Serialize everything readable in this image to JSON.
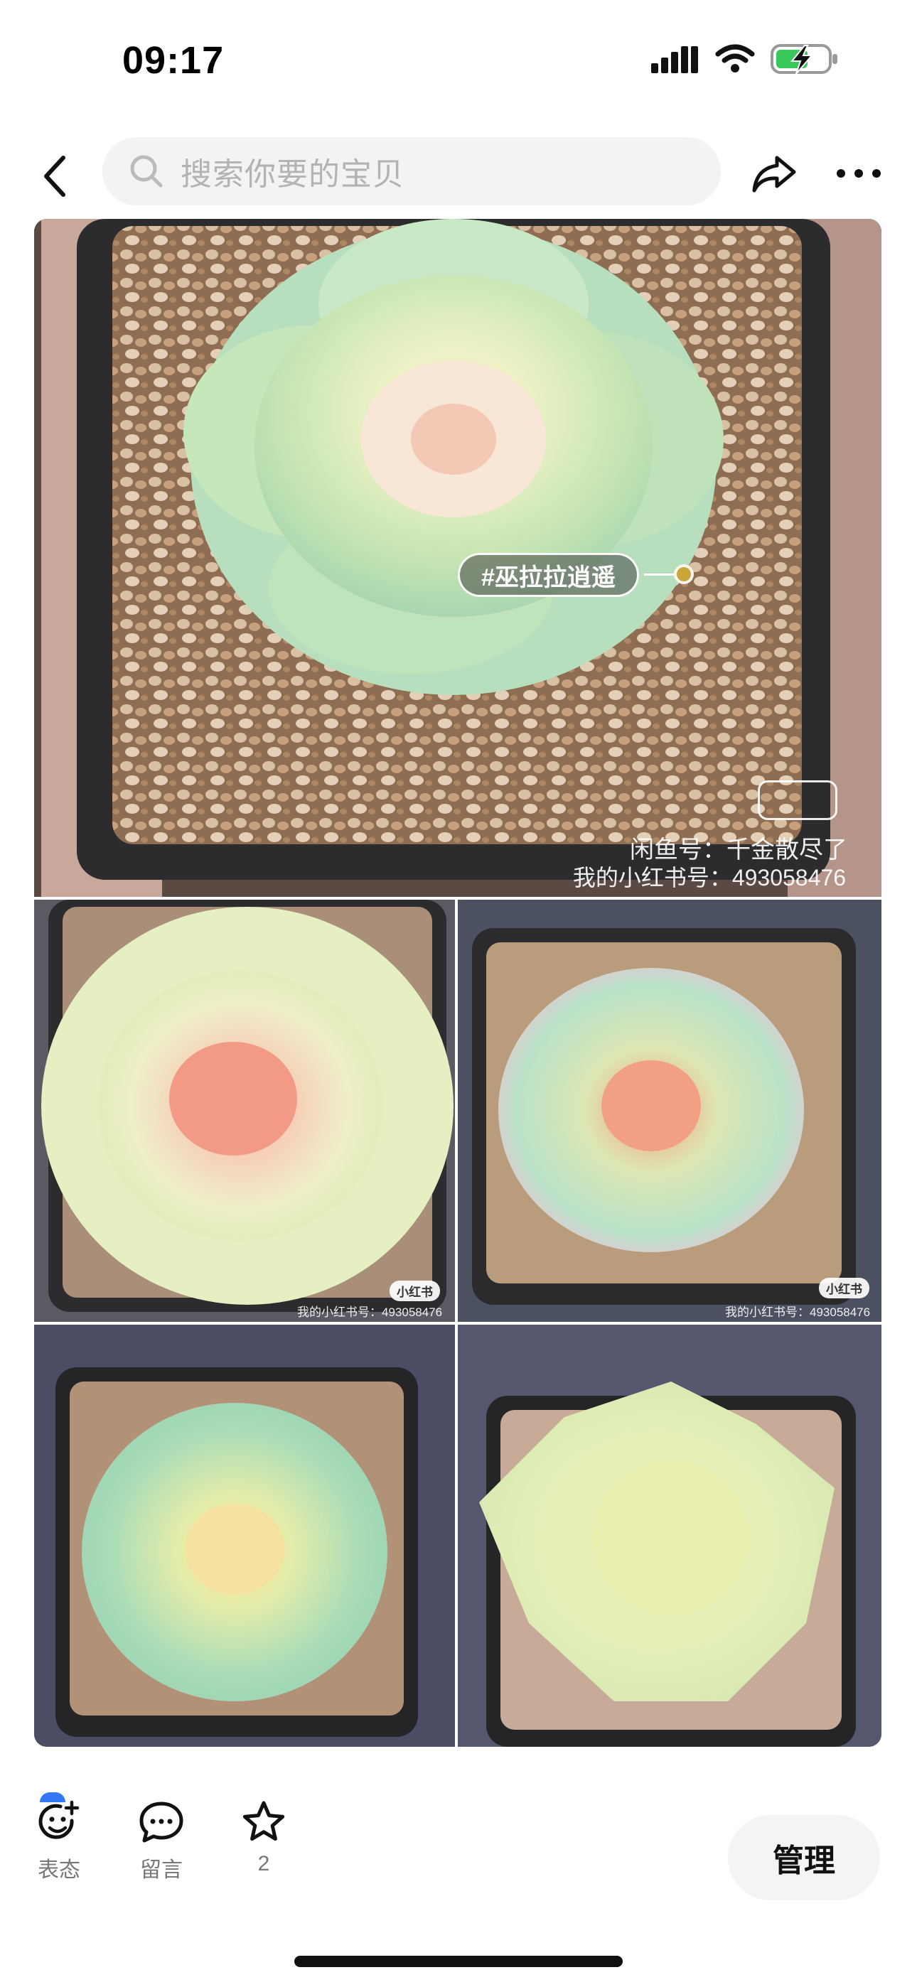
{
  "status_bar": {
    "time": "09:17"
  },
  "nav": {
    "search_placeholder": "搜索你要的宝贝"
  },
  "gallery": {
    "main_tag": "#巫拉拉逍遥",
    "main_watermark_line1": "闲鱼号：千金散尽了",
    "main_watermark_line2": "我的小红书号：493058476",
    "small_watermark": "我的小红书号：493058476",
    "badge": "小红书"
  },
  "actions": {
    "react_label": "表态",
    "comment_label": "留言",
    "favorite_count": "2",
    "manage_label": "管理"
  },
  "colors": {
    "accent_blue": "#3478f6",
    "tag_dot": "#c9a53a"
  }
}
